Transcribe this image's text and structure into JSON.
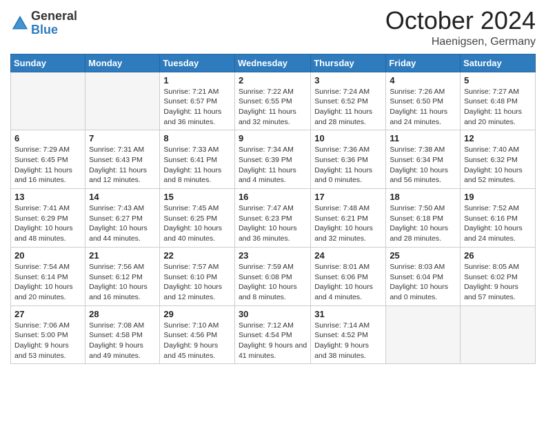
{
  "header": {
    "logo_general": "General",
    "logo_blue": "Blue",
    "month": "October 2024",
    "location": "Haenigsen, Germany"
  },
  "weekdays": [
    "Sunday",
    "Monday",
    "Tuesday",
    "Wednesday",
    "Thursday",
    "Friday",
    "Saturday"
  ],
  "weeks": [
    [
      {
        "day": "",
        "info": ""
      },
      {
        "day": "",
        "info": ""
      },
      {
        "day": "1",
        "info": "Sunrise: 7:21 AM\nSunset: 6:57 PM\nDaylight: 11 hours and 36 minutes."
      },
      {
        "day": "2",
        "info": "Sunrise: 7:22 AM\nSunset: 6:55 PM\nDaylight: 11 hours and 32 minutes."
      },
      {
        "day": "3",
        "info": "Sunrise: 7:24 AM\nSunset: 6:52 PM\nDaylight: 11 hours and 28 minutes."
      },
      {
        "day": "4",
        "info": "Sunrise: 7:26 AM\nSunset: 6:50 PM\nDaylight: 11 hours and 24 minutes."
      },
      {
        "day": "5",
        "info": "Sunrise: 7:27 AM\nSunset: 6:48 PM\nDaylight: 11 hours and 20 minutes."
      }
    ],
    [
      {
        "day": "6",
        "info": "Sunrise: 7:29 AM\nSunset: 6:45 PM\nDaylight: 11 hours and 16 minutes."
      },
      {
        "day": "7",
        "info": "Sunrise: 7:31 AM\nSunset: 6:43 PM\nDaylight: 11 hours and 12 minutes."
      },
      {
        "day": "8",
        "info": "Sunrise: 7:33 AM\nSunset: 6:41 PM\nDaylight: 11 hours and 8 minutes."
      },
      {
        "day": "9",
        "info": "Sunrise: 7:34 AM\nSunset: 6:39 PM\nDaylight: 11 hours and 4 minutes."
      },
      {
        "day": "10",
        "info": "Sunrise: 7:36 AM\nSunset: 6:36 PM\nDaylight: 11 hours and 0 minutes."
      },
      {
        "day": "11",
        "info": "Sunrise: 7:38 AM\nSunset: 6:34 PM\nDaylight: 10 hours and 56 minutes."
      },
      {
        "day": "12",
        "info": "Sunrise: 7:40 AM\nSunset: 6:32 PM\nDaylight: 10 hours and 52 minutes."
      }
    ],
    [
      {
        "day": "13",
        "info": "Sunrise: 7:41 AM\nSunset: 6:29 PM\nDaylight: 10 hours and 48 minutes."
      },
      {
        "day": "14",
        "info": "Sunrise: 7:43 AM\nSunset: 6:27 PM\nDaylight: 10 hours and 44 minutes."
      },
      {
        "day": "15",
        "info": "Sunrise: 7:45 AM\nSunset: 6:25 PM\nDaylight: 10 hours and 40 minutes."
      },
      {
        "day": "16",
        "info": "Sunrise: 7:47 AM\nSunset: 6:23 PM\nDaylight: 10 hours and 36 minutes."
      },
      {
        "day": "17",
        "info": "Sunrise: 7:48 AM\nSunset: 6:21 PM\nDaylight: 10 hours and 32 minutes."
      },
      {
        "day": "18",
        "info": "Sunrise: 7:50 AM\nSunset: 6:18 PM\nDaylight: 10 hours and 28 minutes."
      },
      {
        "day": "19",
        "info": "Sunrise: 7:52 AM\nSunset: 6:16 PM\nDaylight: 10 hours and 24 minutes."
      }
    ],
    [
      {
        "day": "20",
        "info": "Sunrise: 7:54 AM\nSunset: 6:14 PM\nDaylight: 10 hours and 20 minutes."
      },
      {
        "day": "21",
        "info": "Sunrise: 7:56 AM\nSunset: 6:12 PM\nDaylight: 10 hours and 16 minutes."
      },
      {
        "day": "22",
        "info": "Sunrise: 7:57 AM\nSunset: 6:10 PM\nDaylight: 10 hours and 12 minutes."
      },
      {
        "day": "23",
        "info": "Sunrise: 7:59 AM\nSunset: 6:08 PM\nDaylight: 10 hours and 8 minutes."
      },
      {
        "day": "24",
        "info": "Sunrise: 8:01 AM\nSunset: 6:06 PM\nDaylight: 10 hours and 4 minutes."
      },
      {
        "day": "25",
        "info": "Sunrise: 8:03 AM\nSunset: 6:04 PM\nDaylight: 10 hours and 0 minutes."
      },
      {
        "day": "26",
        "info": "Sunrise: 8:05 AM\nSunset: 6:02 PM\nDaylight: 9 hours and 57 minutes."
      }
    ],
    [
      {
        "day": "27",
        "info": "Sunrise: 7:06 AM\nSunset: 5:00 PM\nDaylight: 9 hours and 53 minutes."
      },
      {
        "day": "28",
        "info": "Sunrise: 7:08 AM\nSunset: 4:58 PM\nDaylight: 9 hours and 49 minutes."
      },
      {
        "day": "29",
        "info": "Sunrise: 7:10 AM\nSunset: 4:56 PM\nDaylight: 9 hours and 45 minutes."
      },
      {
        "day": "30",
        "info": "Sunrise: 7:12 AM\nSunset: 4:54 PM\nDaylight: 9 hours and 41 minutes."
      },
      {
        "day": "31",
        "info": "Sunrise: 7:14 AM\nSunset: 4:52 PM\nDaylight: 9 hours and 38 minutes."
      },
      {
        "day": "",
        "info": ""
      },
      {
        "day": "",
        "info": ""
      }
    ]
  ]
}
